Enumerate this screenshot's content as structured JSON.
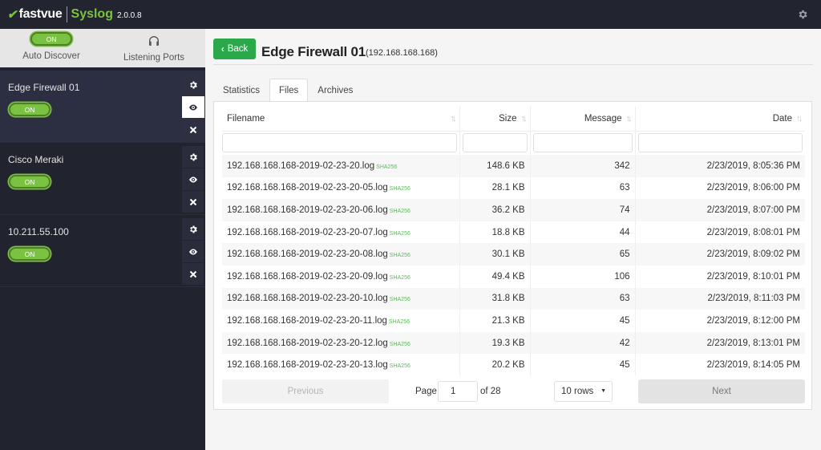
{
  "header": {
    "brand": "fastvue",
    "product": "Syslog",
    "version": "2.0.0.8"
  },
  "sidebar": {
    "auto_discover": {
      "toggle": "ON",
      "label": "Auto Discover"
    },
    "listening_ports": {
      "label": "Listening Ports"
    },
    "devices": [
      {
        "name": "Edge Firewall 01",
        "toggle": "ON",
        "active": true
      },
      {
        "name": "Cisco Meraki",
        "toggle": "ON",
        "active": false
      },
      {
        "name": "10.211.55.100",
        "toggle": "ON",
        "active": false
      }
    ]
  },
  "main": {
    "back_label": "Back",
    "title": "Edge Firewall 01",
    "subtitle": "(192.168.168.168)",
    "tabs": [
      {
        "label": "Statistics",
        "active": false
      },
      {
        "label": "Files",
        "active": true
      },
      {
        "label": "Archives",
        "active": false
      }
    ],
    "table": {
      "columns": [
        "Filename",
        "Size",
        "Message",
        "Date"
      ],
      "hash_label": "SHA256",
      "rows": [
        {
          "filename": "192.168.168.168-2019-02-23-20.log",
          "size": "148.6 KB",
          "message": "342",
          "date": "2/23/2019, 8:05:36 PM"
        },
        {
          "filename": "192.168.168.168-2019-02-23-20-05.log",
          "size": "28.1 KB",
          "message": "63",
          "date": "2/23/2019, 8:06:00 PM"
        },
        {
          "filename": "192.168.168.168-2019-02-23-20-06.log",
          "size": "36.2 KB",
          "message": "74",
          "date": "2/23/2019, 8:07:00 PM"
        },
        {
          "filename": "192.168.168.168-2019-02-23-20-07.log",
          "size": "18.8 KB",
          "message": "44",
          "date": "2/23/2019, 8:08:01 PM"
        },
        {
          "filename": "192.168.168.168-2019-02-23-20-08.log",
          "size": "30.1 KB",
          "message": "65",
          "date": "2/23/2019, 8:09:02 PM"
        },
        {
          "filename": "192.168.168.168-2019-02-23-20-09.log",
          "size": "49.4 KB",
          "message": "106",
          "date": "2/23/2019, 8:10:01 PM"
        },
        {
          "filename": "192.168.168.168-2019-02-23-20-10.log",
          "size": "31.8 KB",
          "message": "63",
          "date": "2/23/2019, 8:11:03 PM"
        },
        {
          "filename": "192.168.168.168-2019-02-23-20-11.log",
          "size": "21.3 KB",
          "message": "45",
          "date": "2/23/2019, 8:12:00 PM"
        },
        {
          "filename": "192.168.168.168-2019-02-23-20-12.log",
          "size": "19.3 KB",
          "message": "42",
          "date": "2/23/2019, 8:13:01 PM"
        },
        {
          "filename": "192.168.168.168-2019-02-23-20-13.log",
          "size": "20.2 KB",
          "message": "45",
          "date": "2/23/2019, 8:14:05 PM"
        }
      ]
    },
    "pagination": {
      "previous_label": "Previous",
      "page_label": "Page",
      "page_value": "1",
      "of_label": "of 28",
      "rows_select": "10 rows",
      "next_label": "Next"
    }
  },
  "colors": {
    "accent_green": "#7cc242",
    "back_button": "#2ba84a",
    "sidebar_bg": "#21232e",
    "topbar_bg": "#22242f"
  }
}
